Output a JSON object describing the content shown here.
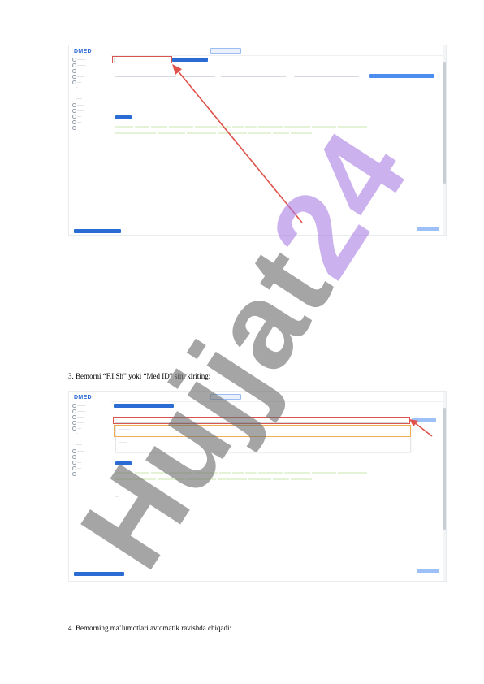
{
  "screenshot1": {
    "logo": "DMED",
    "nav_items": [
      "",
      "",
      "",
      "",
      "",
      "",
      "",
      "",
      "",
      "",
      "",
      "",
      "",
      "",
      ""
    ],
    "search_button": "",
    "tabs": [
      "",
      ""
    ],
    "section_title": "",
    "footer_label": "",
    "user_label": ""
  },
  "screenshot2": {
    "logo": "DMED",
    "search_button": "",
    "tabs": [
      "",
      ""
    ],
    "footer_label": "",
    "user_label": ""
  },
  "captions": {
    "step3": "3. Bemorni “F.I.Sh” yoki “Med ID” sini kiriting:",
    "step4": "4. Bemorning ma’lumotlari avtomatik ravishda chiqadi:"
  },
  "watermark": {
    "part1": "Hujjat",
    "part2": "24"
  },
  "colors": {
    "accent": "#2b6cd4",
    "highlight_red": "#d9534f",
    "highlight_orange": "#f0ad4e",
    "chip_green": "#e4f3d6"
  }
}
